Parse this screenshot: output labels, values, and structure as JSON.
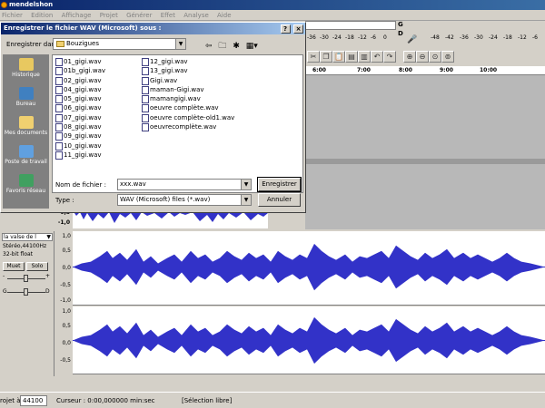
{
  "app": {
    "title": "mendelshon"
  },
  "menu": [
    "Fichier",
    "Edition",
    "Affichage",
    "Projet",
    "Générer",
    "Effet",
    "Analyse",
    "Aide"
  ],
  "meters": {
    "left_ticks": [
      "-36",
      "-30",
      "-24",
      "-18",
      "-12",
      "-6",
      "0"
    ],
    "right_ticks": [
      "-48",
      "-42",
      "-36",
      "-30",
      "-24",
      "-18",
      "-12",
      "-6"
    ],
    "l_label": "G",
    "r_label": "D"
  },
  "ruler": [
    "6:00",
    "7:00",
    "8:00",
    "9:00",
    "10:00"
  ],
  "dialog": {
    "title": "Enregistrer le fichier WAV (Microsoft) sous :",
    "save_in_label": "Enregistrer dans :",
    "save_in_value": "Bouzigues",
    "places": [
      "Historique",
      "Bureau",
      "Mes documents",
      "Poste de travail",
      "Favoris réseau"
    ],
    "files_col1": [
      "01_gigi.wav",
      "01b_gigi.wav",
      "02_gigi.wav",
      "04_gigi.wav",
      "05_gigi.wav",
      "06_gigi.wav",
      "07_gigi.wav",
      "08_gigi.wav",
      "09_gigi.wav",
      "10_gigi.wav",
      "11_gigi.wav"
    ],
    "files_col2": [
      "12_gigi.wav",
      "13_gigi.wav",
      "Gigi.wav",
      "maman-Gigi.wav",
      "mamangigi.wav",
      "oeuvre complète.wav",
      "oeuvre complète-old1.wav",
      "oeuvrecomplète.wav"
    ],
    "filename_label": "Nom de fichier :",
    "filename_value": "xxx.wav",
    "type_label": "Type :",
    "type_value": "WAV (Microsoft) files (*.wav)",
    "save_button": "Enregistrer",
    "cancel_button": "Annuler"
  },
  "track": {
    "name": "la valse de l",
    "info1": "Stéréo,44100Hz",
    "info2": "32-bit float",
    "mute": "Muet",
    "solo": "Solo",
    "gain_minus": "-",
    "gain_plus": "+",
    "pan_left": "G",
    "pan_right": "D"
  },
  "track1_scale": [
    "-0,5",
    "-1,0"
  ],
  "scale": [
    "1,0",
    "0,5",
    "0,0",
    "-0,5",
    "-1,0"
  ],
  "scale2": [
    "1,0",
    "0,5",
    "0,0",
    "-0,5"
  ],
  "status": {
    "rate_label": "rojet à :",
    "rate_value": "44100",
    "cursor": "Curseur : 0:00,000000 min:sec",
    "selection": "[Sélection libre]"
  }
}
